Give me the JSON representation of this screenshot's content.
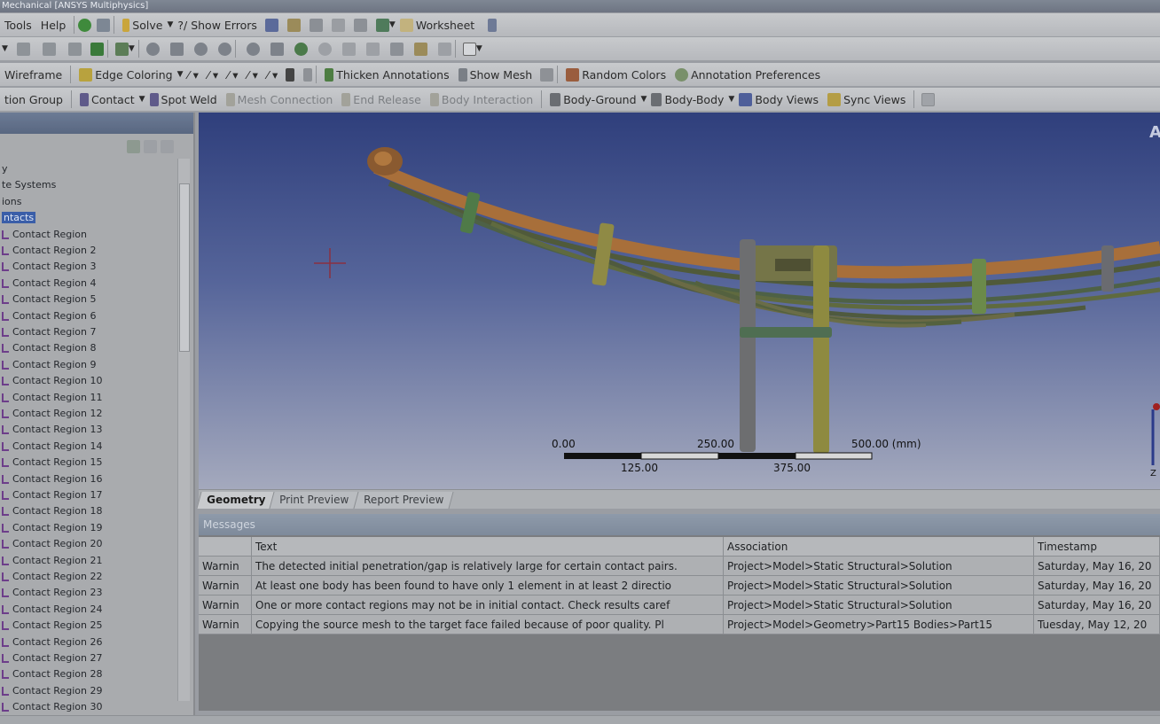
{
  "window": {
    "title": "Mechanical [ANSYS Multiphysics]"
  },
  "toolbar1": [
    {
      "label": "Tools"
    },
    {
      "label": "Help"
    },
    {
      "label": "Solve"
    },
    {
      "label": "?/ Show Errors"
    },
    {
      "label": "Worksheet"
    }
  ],
  "toolbar3": {
    "wireframe": "Wireframe",
    "edge_coloring": "Edge Coloring",
    "thicken": "Thicken Annotations",
    "show_mesh": "Show Mesh",
    "random_colors": "Random Colors",
    "annotation_prefs": "Annotation Preferences"
  },
  "toolbar4": {
    "group": "tion Group",
    "contact": "Contact",
    "spot_weld": "Spot Weld",
    "mesh_connection": "Mesh Connection",
    "end_release": "End Release",
    "body_interaction": "Body Interaction",
    "body_ground": "Body-Ground",
    "body_body": "Body-Body",
    "body_views": "Body Views",
    "sync_views": "Sync Views"
  },
  "tree": {
    "top_items": [
      "y",
      "te Systems",
      "ions",
      "ntacts"
    ],
    "contact_regions": [
      "Contact Region",
      "Contact Region 2",
      "Contact Region 3",
      "Contact Region 4",
      "Contact Region 5",
      "Contact Region 6",
      "Contact Region 7",
      "Contact Region 8",
      "Contact Region 9",
      "Contact Region 10",
      "Contact Region 11",
      "Contact Region 12",
      "Contact Region 13",
      "Contact Region 14",
      "Contact Region 15",
      "Contact Region 16",
      "Contact Region 17",
      "Contact Region 18",
      "Contact Region 19",
      "Contact Region 20",
      "Contact Region 21",
      "Contact Region 22",
      "Contact Region 23",
      "Contact Region 24",
      "Contact Region 25",
      "Contact Region 26",
      "Contact Region 27",
      "Contact Region 28",
      "Contact Region 29",
      "Contact Region 30"
    ]
  },
  "viewport": {
    "scale_labels": {
      "s0": "0.00",
      "s250": "250.00",
      "s500": "500.00 (mm)",
      "s125": "125.00",
      "s375": "375.00"
    },
    "corner_letter": "A",
    "axis_letter": "Z"
  },
  "tabs": [
    "Geometry",
    "Print Preview",
    "Report Preview"
  ],
  "messages": {
    "title": "Messages",
    "columns": [
      "",
      "Text",
      "Association",
      "Timestamp"
    ],
    "rows": [
      {
        "type": "Warnin",
        "text": "The detected initial penetration/gap is relatively large for certain contact pairs.",
        "assoc": "Project>Model>Static Structural>Solution",
        "time": "Saturday, May 16, 20"
      },
      {
        "type": "Warnin",
        "text": "At least one body has been found to have only 1 element in at least 2 directio",
        "assoc": "Project>Model>Static Structural>Solution",
        "time": "Saturday, May 16, 20"
      },
      {
        "type": "Warnin",
        "text": "One or more contact regions may not be in initial contact.  Check results caref",
        "assoc": "Project>Model>Static Structural>Solution",
        "time": "Saturday, May 16, 20"
      },
      {
        "type": "Warnin",
        "text": "Copying the source mesh to the target face failed because of poor quality.  Pl",
        "assoc": "Project>Model>Geometry>Part15 Bodies>Part15",
        "time": "Tuesday, May 12, 20"
      }
    ]
  },
  "colors": {
    "spring_top": "#a86f3a",
    "spring_leaf": "#7d7c4a",
    "clip_green": "#6b8a4a",
    "bolt": "#8e8a66"
  }
}
